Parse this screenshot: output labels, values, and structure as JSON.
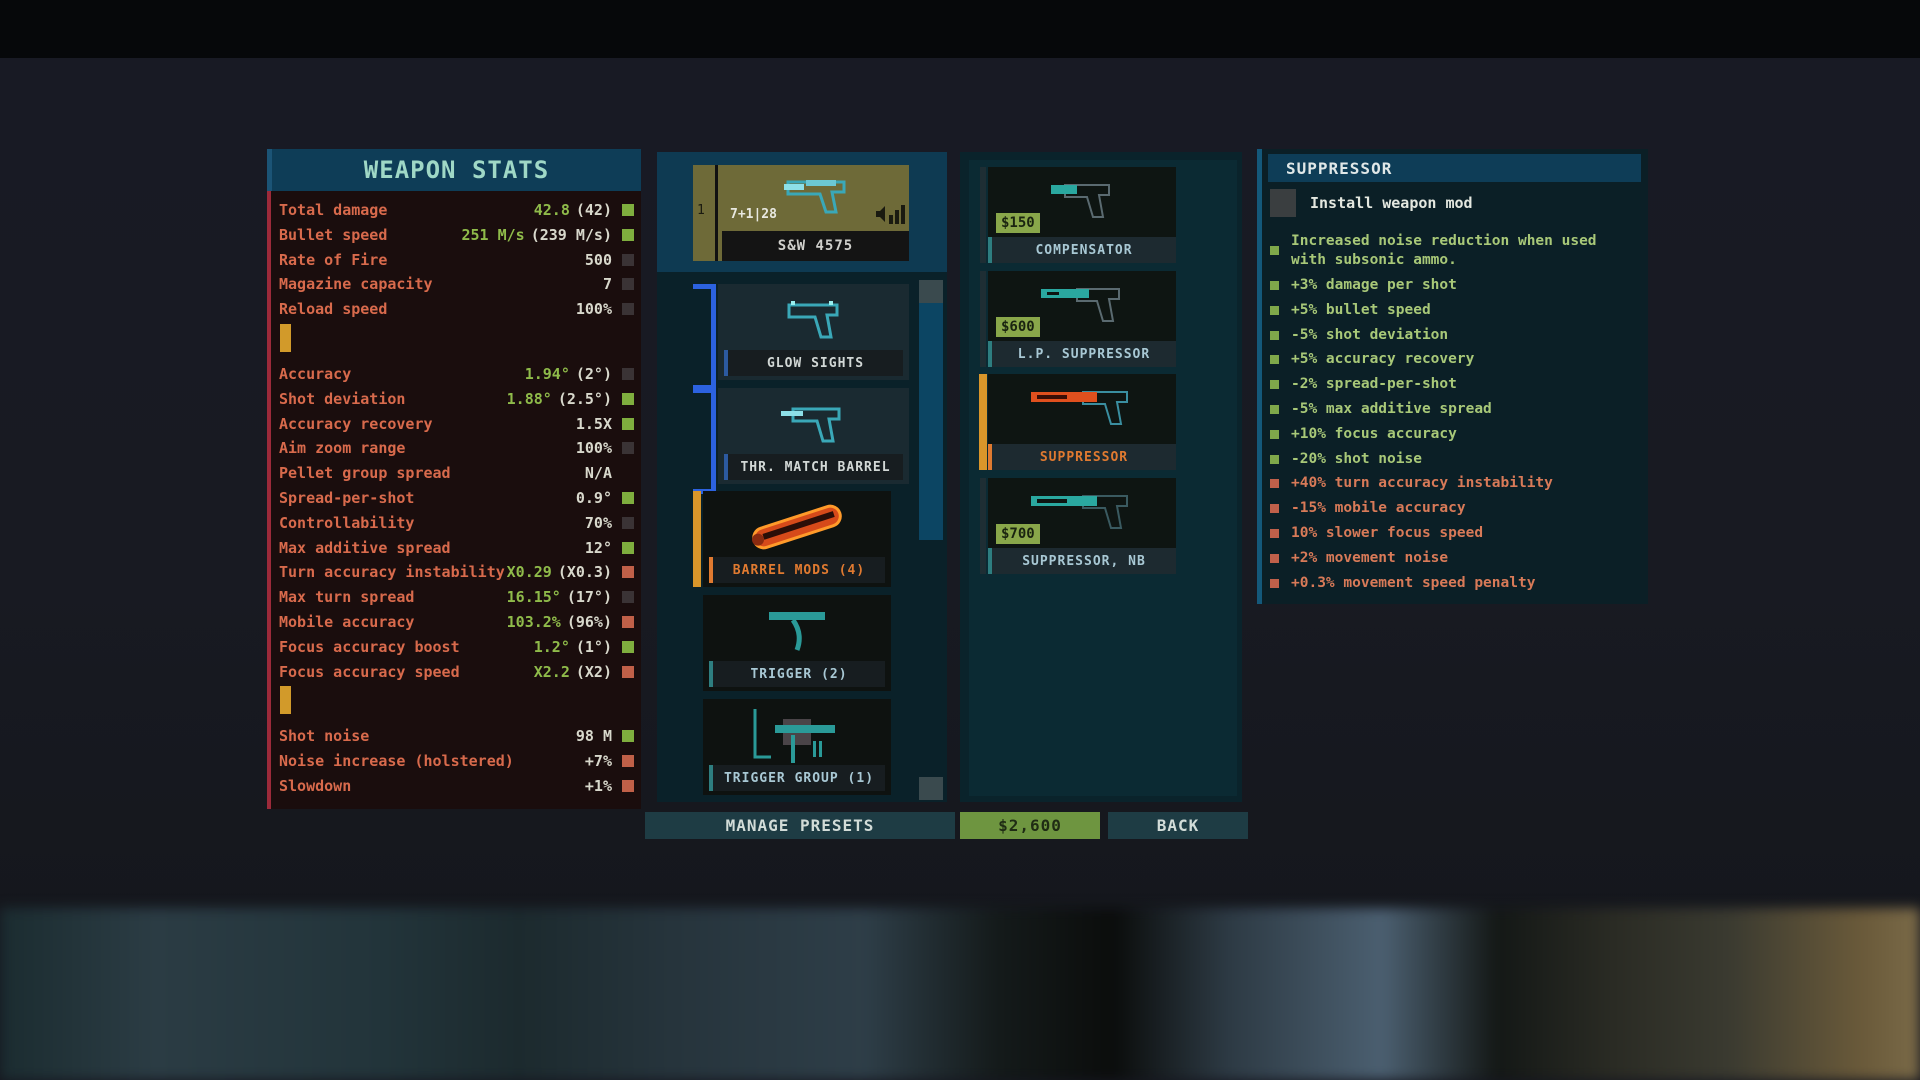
{
  "stats_panel": {
    "title": "WEAPON STATS",
    "groups": [
      [
        {
          "label": "Total damage",
          "modified": "42.8",
          "base": "(42)",
          "indicator": "good"
        },
        {
          "label": "Bullet speed",
          "modified": "251 M/s",
          "base": "(239 M/s)",
          "indicator": "good"
        },
        {
          "label": "Rate of Fire",
          "modified": "",
          "base": "500",
          "indicator": "neutral"
        },
        {
          "label": "Magazine capacity",
          "modified": "",
          "base": "7",
          "indicator": "neutral"
        },
        {
          "label": "Reload speed",
          "modified": "",
          "base": "100%",
          "indicator": "neutral"
        }
      ],
      [
        {
          "label": "Accuracy",
          "modified": "1.94°",
          "base": "(2°)",
          "indicator": "neutral"
        },
        {
          "label": "Shot deviation",
          "modified": "1.88°",
          "base": "(2.5°)",
          "indicator": "good"
        },
        {
          "label": "Accuracy recovery",
          "modified": "",
          "base": "1.5X",
          "indicator": "good"
        },
        {
          "label": "Aim zoom range",
          "modified": "",
          "base": "100%",
          "indicator": "neutral"
        },
        {
          "label": "Pellet group spread",
          "modified": "",
          "base": "N/A",
          "indicator": "none"
        },
        {
          "label": "Spread-per-shot",
          "modified": "",
          "base": "0.9°",
          "indicator": "good"
        },
        {
          "label": "Controllability",
          "modified": "",
          "base": "70%",
          "indicator": "neutral"
        },
        {
          "label": "Max additive spread",
          "modified": "",
          "base": "12°",
          "indicator": "good"
        },
        {
          "label": "Turn accuracy instability",
          "modified": "X0.29",
          "base": "(X0.3)",
          "indicator": "bad"
        },
        {
          "label": "Max turn spread",
          "modified": "16.15°",
          "base": "(17°)",
          "indicator": "neutral"
        },
        {
          "label": "Mobile accuracy",
          "modified": "103.2%",
          "base": "(96%)",
          "indicator": "bad"
        },
        {
          "label": "Focus accuracy boost",
          "modified": "1.2°",
          "base": "(1°)",
          "indicator": "good"
        },
        {
          "label": "Focus accuracy speed",
          "modified": "X2.2",
          "base": "(X2)",
          "indicator": "bad"
        }
      ],
      [
        {
          "label": "Shot noise",
          "modified": "",
          "base": "98 M",
          "indicator": "good"
        },
        {
          "label": "Noise increase (holstered)",
          "modified": "",
          "base": "+7%",
          "indicator": "bad"
        },
        {
          "label": "Slowdown",
          "modified": "",
          "base": "+1%",
          "indicator": "bad"
        }
      ]
    ]
  },
  "weapon": {
    "slot_number": "1",
    "ammo": "7+1|28",
    "name": "S&W 4575",
    "icon": "pistol-icon",
    "noise_icon": "volume-bars-icon"
  },
  "slots": [
    {
      "label": "GLOW SIGHTS",
      "icon": "pistol-sights-icon",
      "equipped": true
    },
    {
      "label": "THR. MATCH BARREL",
      "icon": "pistol-barrel-icon",
      "equipped": true
    },
    {
      "label": "BARREL MODS (4)",
      "icon": "suppressor-icon",
      "selected": true
    },
    {
      "label": "TRIGGER (2)",
      "icon": "trigger-icon"
    },
    {
      "label": "TRIGGER GROUP (1)",
      "icon": "trigger-group-icon"
    }
  ],
  "mods": [
    {
      "label": "COMPENSATOR",
      "price": "$150",
      "icon": "compensator-pistol-icon"
    },
    {
      "label": "L.P. SUPPRESSOR",
      "price": "$600",
      "icon": "lp-suppressor-pistol-icon"
    },
    {
      "label": "SUPPRESSOR",
      "price": "",
      "icon": "suppressor-pistol-icon",
      "selected": true
    },
    {
      "label": "SUPPRESSOR, NB",
      "price": "$700",
      "icon": "nb-suppressor-pistol-icon"
    }
  ],
  "details": {
    "title": "SUPPRESSOR",
    "action": "Install weapon mod",
    "effects": [
      {
        "text": "Increased noise reduction when used with subsonic ammo.",
        "type": "good"
      },
      {
        "text": "+3% damage per shot",
        "type": "good"
      },
      {
        "text": "+5% bullet speed",
        "type": "good"
      },
      {
        "text": "-5% shot deviation",
        "type": "good"
      },
      {
        "text": "+5% accuracy recovery",
        "type": "good"
      },
      {
        "text": "-2% spread-per-shot",
        "type": "good"
      },
      {
        "text": "-5% max additive spread",
        "type": "good"
      },
      {
        "text": "+10% focus accuracy",
        "type": "good"
      },
      {
        "text": "-20% shot noise",
        "type": "good"
      },
      {
        "text": "+40% turn accuracy instability",
        "type": "bad"
      },
      {
        "text": "-15% mobile accuracy",
        "type": "bad"
      },
      {
        "text": "10% slower focus speed",
        "type": "bad"
      },
      {
        "text": "+2% movement noise",
        "type": "bad"
      },
      {
        "text": "+0.3% movement speed penalty",
        "type": "bad"
      }
    ]
  },
  "buttons": {
    "presets": "MANAGE PRESETS",
    "money": "$2,600",
    "back": "BACK"
  },
  "colors": {
    "good": "#7fae3e",
    "bad": "#c06048",
    "accent": "#0e3d57",
    "selected": "#d9962a",
    "equipped": "#2c62e0"
  }
}
